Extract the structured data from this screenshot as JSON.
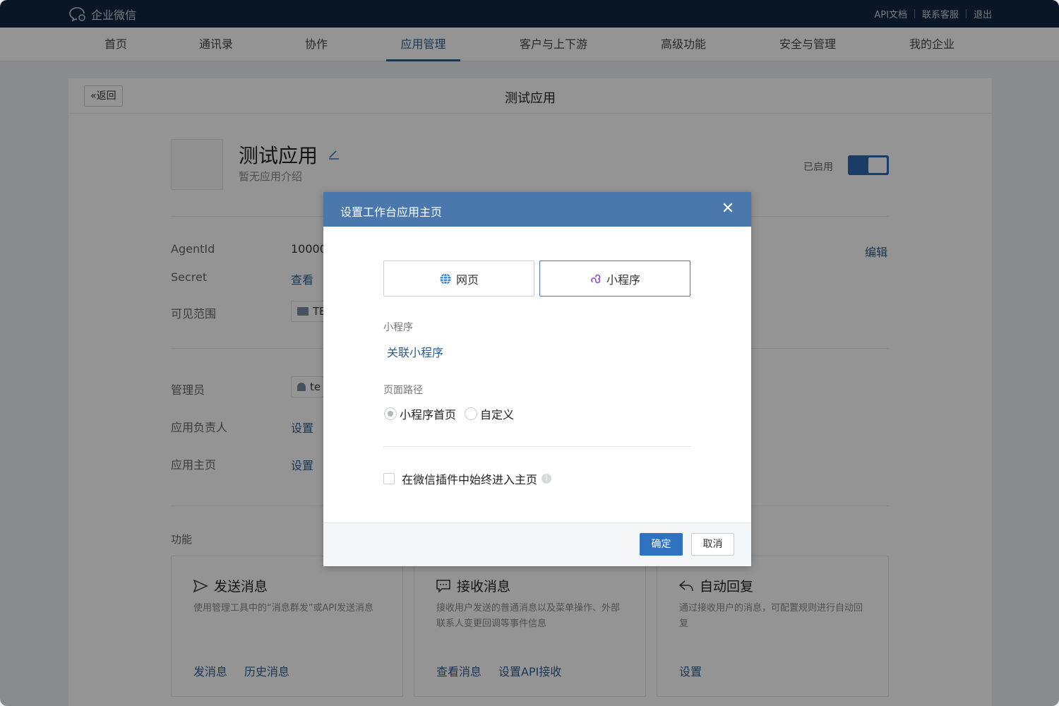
{
  "topbar": {
    "logo_text": "企业微信",
    "links": [
      "API文档",
      "联系客服",
      "退出"
    ]
  },
  "nav": {
    "items": [
      "首页",
      "通讯录",
      "协作",
      "应用管理",
      "客户与上下游",
      "高级功能",
      "安全与管理",
      "我的企业"
    ],
    "active": "应用管理"
  },
  "card": {
    "back_label": "返回",
    "title": "测试应用"
  },
  "app": {
    "name": "测试应用",
    "description": "暂无应用介绍",
    "status_label": "已启用",
    "enabled": true
  },
  "details": {
    "agentid_label": "AgentId",
    "agentid_value": "10000",
    "secret_label": "Secret",
    "secret_link": "查看",
    "scope_label": "可见范围",
    "scope_value": "TE",
    "edit_link": "编辑",
    "admin_label": "管理员",
    "admin_value": "te",
    "owner_label": "应用负责人",
    "owner_link": "设置",
    "homepage_label": "应用主页",
    "homepage_link": "设置"
  },
  "features": {
    "section_label": "功能",
    "items": [
      {
        "title": "发送消息",
        "icon": "send-icon",
        "desc": "使用管理工具中的“消息群发”或API发送消息",
        "links": [
          "发消息",
          "历史消息"
        ]
      },
      {
        "title": "接收消息",
        "icon": "chat-icon",
        "desc": "接收用户发送的普通消息以及菜单操作、外部联系人变更回调等事件信息",
        "links": [
          "查看消息",
          "设置API接收"
        ]
      },
      {
        "title": "自动回复",
        "icon": "reply-icon",
        "desc": "通过接收用户的消息，可配置规则进行自动回复",
        "links": [
          "设置"
        ]
      }
    ]
  },
  "modal": {
    "title": "设置工作台应用主页",
    "tab_web": "网页",
    "tab_miniprogram": "小程序",
    "active_tab": "小程序",
    "miniprogram_label": "小程序",
    "associate_link": "关联小程序",
    "path_label": "页面路径",
    "radio_home": "小程序首页",
    "radio_custom": "自定义",
    "radio_selected": "小程序首页",
    "checkbox_label": "在微信插件中始终进入主页",
    "checkbox_checked": false,
    "ok_label": "确定",
    "cancel_label": "取消"
  },
  "colors": {
    "topbar": "#0f2742",
    "accent": "#2c5d8f",
    "modal_header": "#4a78ad",
    "primary_button": "#2f72c0"
  }
}
